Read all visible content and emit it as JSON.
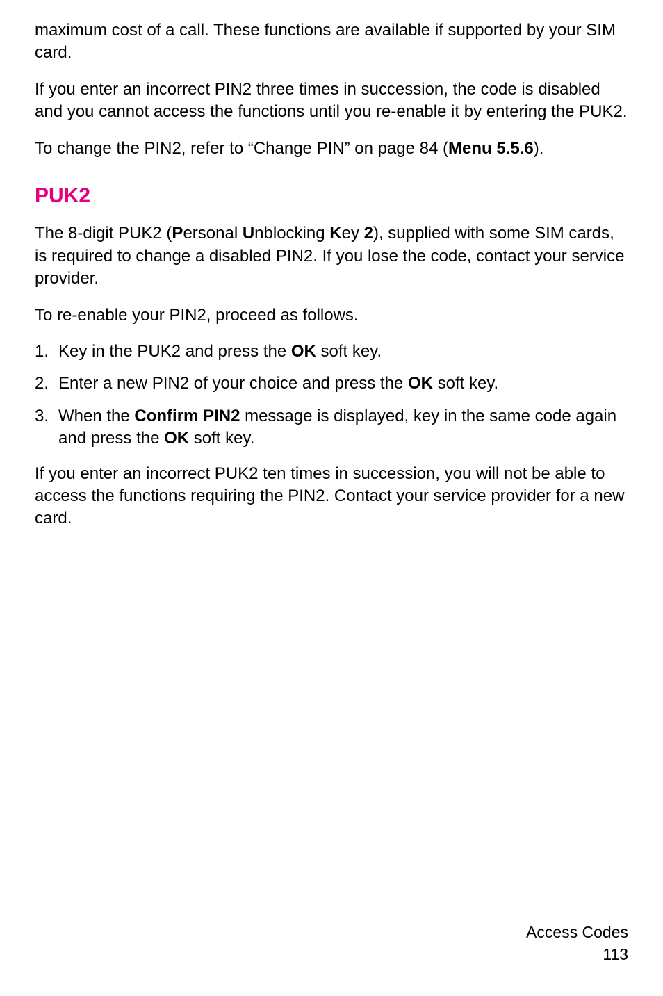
{
  "intro": {
    "p1": "maximum cost of a call. These functions are available if supported by your SIM card.",
    "p2": "If you enter an incorrect PIN2 three times in succession, the code is disabled and you cannot access the functions until you re-enable it by entering the PUK2.",
    "p3_pre": "To change the PIN2, refer to “Change PIN” on page 84 (",
    "p3_bold": "Menu 5.5.6",
    "p3_post": ")."
  },
  "section": {
    "heading": "PUK2",
    "p1_pre": "The 8-digit PUK2 (",
    "p1_b1": "P",
    "p1_t1": "ersonal ",
    "p1_b2": "U",
    "p1_t2": "nblocking ",
    "p1_b3": "K",
    "p1_t3": "ey ",
    "p1_b4": "2",
    "p1_post": "), supplied with some SIM cards, is required to change a disabled PIN2. If you lose the code, contact your service provider.",
    "p2": "To re-enable your PIN2, proceed as follows.",
    "list": [
      {
        "num": "1.",
        "pre": "Key in the PUK2 and press the ",
        "b1": "OK",
        "post": " soft key."
      },
      {
        "num": "2.",
        "pre": "Enter a new PIN2 of your choice and press the ",
        "b1": "OK",
        "post": " soft key."
      },
      {
        "num": "3.",
        "pre": "When the ",
        "b1": "Confirm PIN2",
        "mid": " message is displayed, key in the same code again and press the ",
        "b2": "OK",
        "post": " soft key."
      }
    ],
    "p3": "If you enter an incorrect PUK2 ten times in succession, you will not be able to access the functions requiring the PIN2. Contact your service provider for a new card."
  },
  "footer": {
    "title": "Access Codes",
    "page": "113"
  }
}
